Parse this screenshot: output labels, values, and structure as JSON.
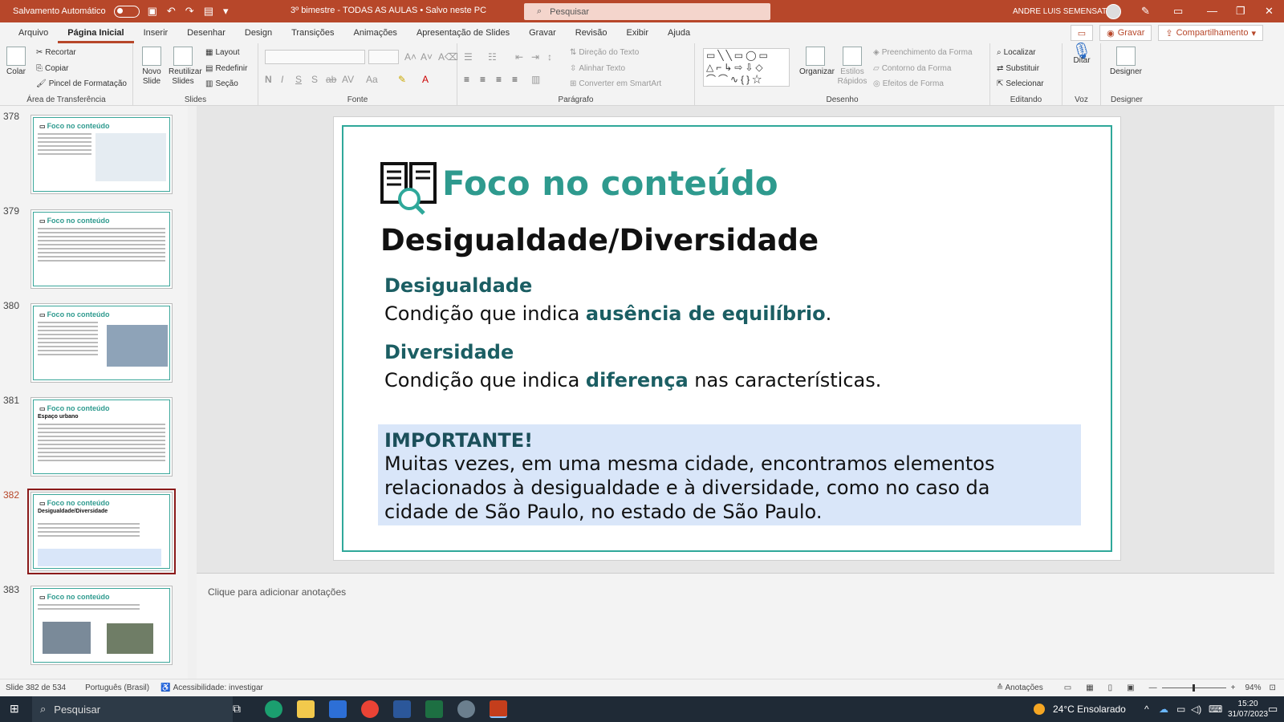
{
  "titlebar": {
    "autosave": "Salvamento Automático",
    "doc_title": "3º bimestre - TODAS AS AULAS • Salvo neste PC",
    "search_placeholder": "Pesquisar",
    "user": "ANDRE LUIS SEMENSATO"
  },
  "tabs": [
    "Arquivo",
    "Página Inicial",
    "Inserir",
    "Desenhar",
    "Design",
    "Transições",
    "Animações",
    "Apresentação de Slides",
    "Gravar",
    "Revisão",
    "Exibir",
    "Ajuda"
  ],
  "tabs_right": {
    "record": "Gravar",
    "share": "Compartilhamento"
  },
  "ribbon": {
    "clipboard": {
      "label": "Área de Transferência",
      "paste": "Colar",
      "cut": "Recortar",
      "copy": "Copiar",
      "format_painter": "Pincel de Formatação"
    },
    "slides": {
      "label": "Slides",
      "new": "Novo Slide",
      "reuse": "Reutilizar Slides",
      "layout": "Layout",
      "reset": "Redefinir",
      "section": "Seção"
    },
    "font": {
      "label": "Fonte"
    },
    "paragraph": {
      "label": "Parágrafo",
      "text_direction": "Direção do Texto",
      "align_text": "Alinhar Texto",
      "smartart": "Converter em SmartArt"
    },
    "drawing": {
      "label": "Desenho",
      "arrange": "Organizar",
      "quick_styles": "Estilos Rápidos",
      "fill": "Preenchimento da Forma",
      "outline": "Contorno da Forma",
      "effects": "Efeitos de Forma"
    },
    "editing": {
      "label": "Editando",
      "find": "Localizar",
      "replace": "Substituir",
      "select": "Selecionar"
    },
    "voice": {
      "label": "Voz",
      "dictate": "Ditar"
    },
    "designer": {
      "label": "Designer",
      "btn": "Designer"
    }
  },
  "thumbnails": [
    {
      "num": "378",
      "title": "Foco no conteúdo"
    },
    {
      "num": "379",
      "title": "Foco no conteúdo"
    },
    {
      "num": "380",
      "title": "Foco no conteúdo"
    },
    {
      "num": "381",
      "title": "Foco no conteúdo",
      "sub": "Espaço urbano"
    },
    {
      "num": "382",
      "title": "Foco no conteúdo",
      "sub": "Desigualdade/Diversidade"
    },
    {
      "num": "383",
      "title": "Foco no conteúdo"
    }
  ],
  "slide": {
    "title": "Foco no conteúdo",
    "subtitle": "Desigualdade/Diversidade",
    "h1": "Desigualdade",
    "p1_pre": "Condição que indica ",
    "p1_bold": "ausência de equilíbrio",
    "p1_post": ".",
    "h2": "Diversidade",
    "p2_pre": "Condição que indica ",
    "p2_bold": "diferença",
    "p2_post": " nas características.",
    "important_head": "IMPORTANTE!",
    "important_l1": "Muitas vezes, em uma mesma cidade, encontramos elementos",
    "important_l2": "relacionados à desigualdade e à diversidade, como no caso da",
    "important_l3": "cidade de São Paulo, no estado de São Paulo."
  },
  "notes_placeholder": "Clique para adicionar anotações",
  "status": {
    "slide": "Slide 382 de 534",
    "lang": "Português (Brasil)",
    "access": "Acessibilidade: investigar",
    "notes": "Anotações",
    "zoom": "94%"
  },
  "taskbar": {
    "search": "Pesquisar",
    "weather": "24°C  Ensolarado",
    "time": "15:20",
    "date": "31/07/2023"
  }
}
